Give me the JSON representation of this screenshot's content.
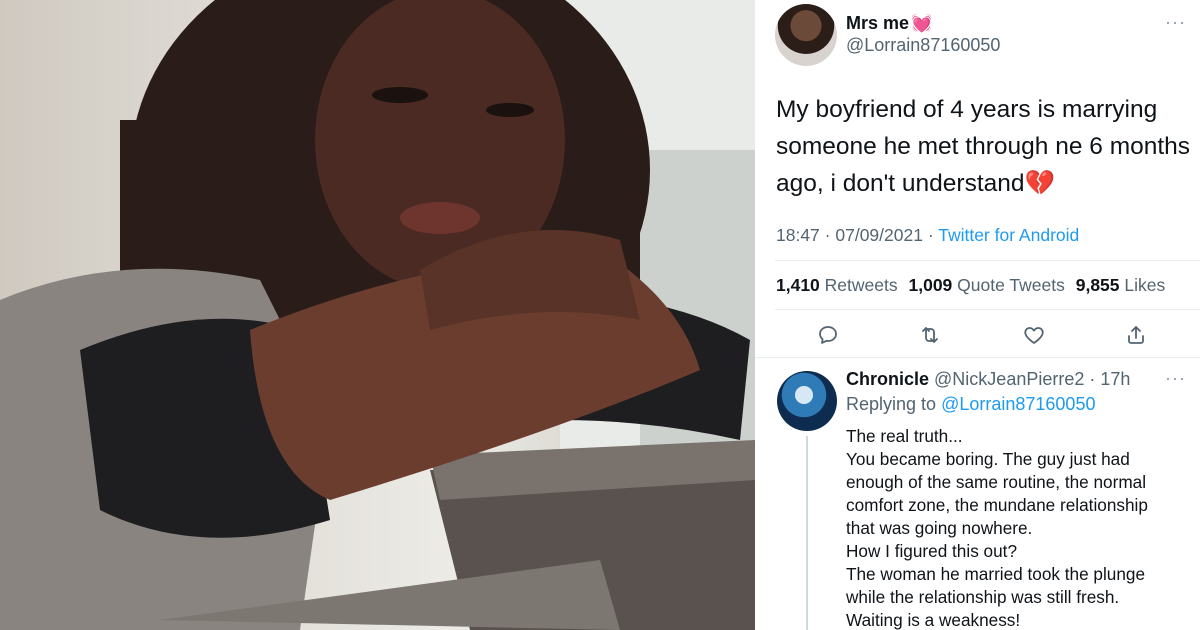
{
  "tweet": {
    "display_name": "Mrs me",
    "name_emoji": "💓",
    "handle": "@Lorrain87160050",
    "text_lines": [
      "My boyfriend of 4 years is marrying",
      "someone he met through ne 6 months",
      "ago, i don't understand"
    ],
    "text_emoji": "💔",
    "time": "18:47",
    "date": "07/09/2021",
    "source": "Twitter for Android",
    "retweets_count": "1,410",
    "retweets_label": "Retweets",
    "quote_count": "1,009",
    "quote_label": "Quote Tweets",
    "likes_count": "9,855",
    "likes_label": "Likes",
    "more": "···"
  },
  "reply": {
    "display_name": "Chronicle",
    "handle": "@NickJeanPierre2",
    "age": "17h",
    "replying_prefix": "Replying to",
    "replying_to": "@Lorrain87160050",
    "more": "···",
    "lines": [
      "The real truth...",
      "You became boring. The guy just had",
      "enough of the same routine, the normal",
      "comfort zone, the mundane relationship",
      "that was going nowhere.",
      "How I figured this out?",
      "The woman he married took the plunge",
      "while the relationship was still fresh.",
      "Waiting is a weakness!"
    ]
  },
  "colors": {
    "link": "#1d9bf0",
    "secondary_text": "#536471",
    "primary_text": "#0f1419"
  },
  "icons": [
    "reply-icon",
    "retweet-icon",
    "like-icon",
    "share-icon",
    "more-icon"
  ]
}
